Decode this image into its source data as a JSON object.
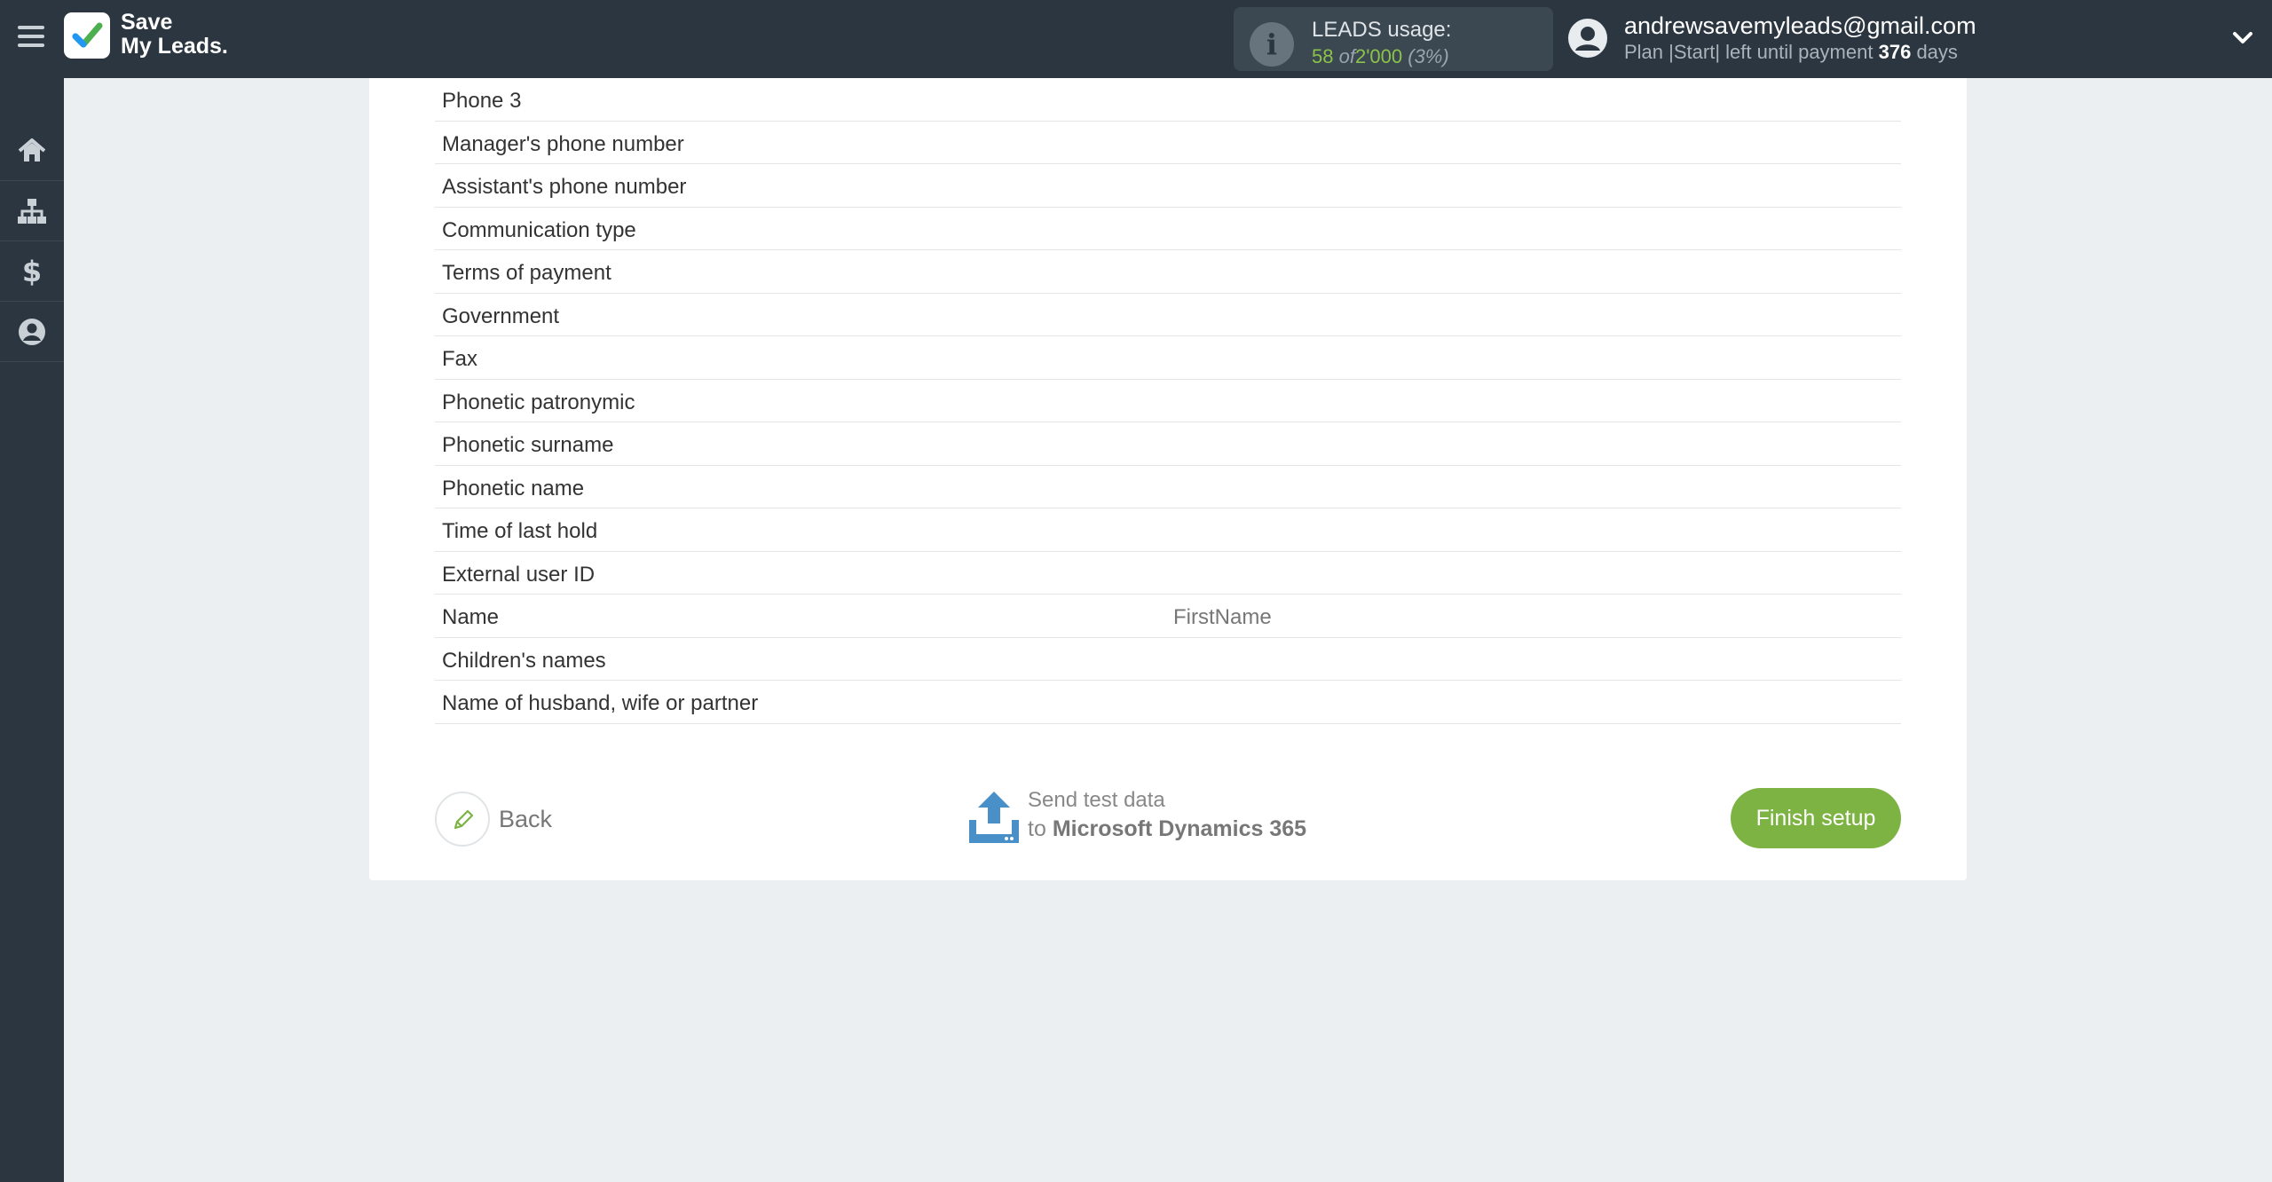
{
  "brand": {
    "line1": "Save",
    "line2": "My Leads."
  },
  "usage": {
    "title": "LEADS usage:",
    "used": "58",
    "of": "of",
    "total": "2'000",
    "percent": "(3%)"
  },
  "account": {
    "email": "andrewsavemyleads@gmail.com",
    "plan_prefix": "Plan |Start| left until payment",
    "days": "376",
    "days_suffix": "days"
  },
  "sidebar": {
    "items": [
      {
        "icon": "home-icon"
      },
      {
        "icon": "sitemap-icon"
      },
      {
        "icon": "dollar-icon"
      },
      {
        "icon": "user-circle-icon"
      }
    ]
  },
  "fields": [
    {
      "label": "Phone 3",
      "value": ""
    },
    {
      "label": "Manager's phone number",
      "value": ""
    },
    {
      "label": "Assistant's phone number",
      "value": ""
    },
    {
      "label": "Communication type",
      "value": ""
    },
    {
      "label": "Terms of payment",
      "value": ""
    },
    {
      "label": "Government",
      "value": ""
    },
    {
      "label": "Fax",
      "value": ""
    },
    {
      "label": "Phonetic patronymic",
      "value": ""
    },
    {
      "label": "Phonetic surname",
      "value": ""
    },
    {
      "label": "Phonetic name",
      "value": ""
    },
    {
      "label": "Time of last hold",
      "value": ""
    },
    {
      "label": "External user ID",
      "value": ""
    },
    {
      "label": "Name",
      "value": "FirstName"
    },
    {
      "label": "Children's names",
      "value": ""
    },
    {
      "label": "Name of husband, wife or partner",
      "value": ""
    }
  ],
  "footer": {
    "back_label": "Back",
    "send_line1": "Send test data",
    "send_to": "to",
    "send_target": "Microsoft Dynamics 365",
    "finish_label": "Finish setup"
  },
  "colors": {
    "accent": "#7cb342",
    "topbar": "#2b3640",
    "send_icon": "#4a90c8"
  }
}
